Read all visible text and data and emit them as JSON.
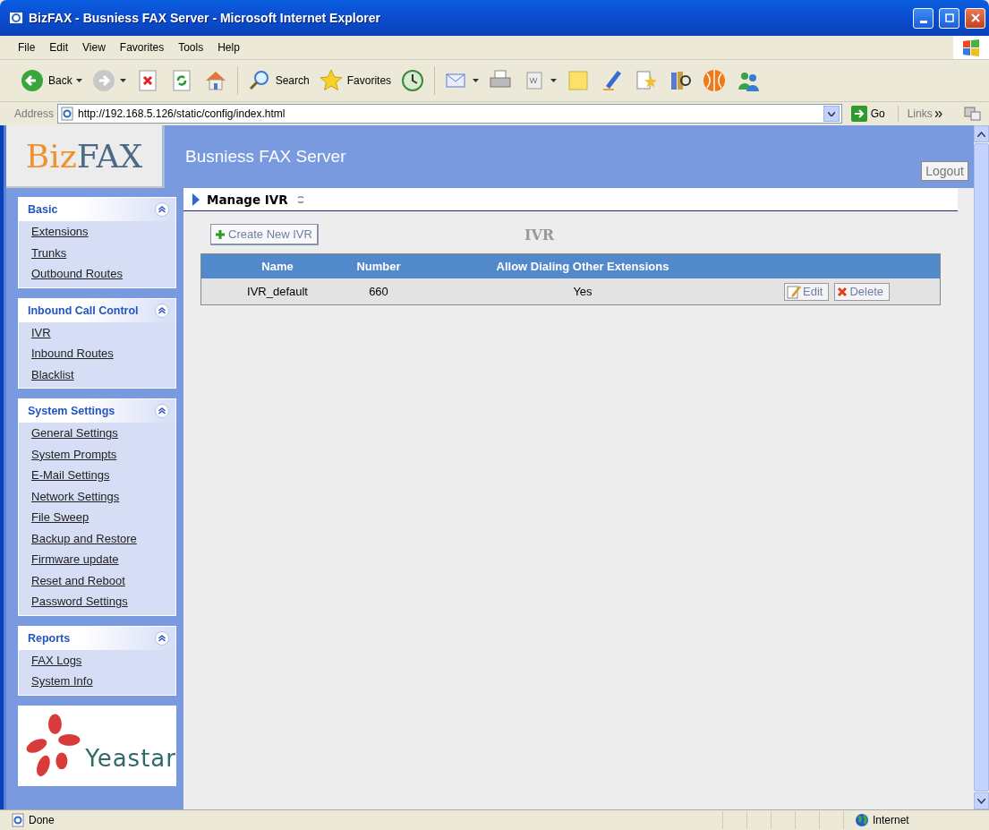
{
  "window": {
    "title": "BizFAX - Busniess FAX Server - Microsoft Internet Explorer"
  },
  "menu": [
    "File",
    "Edit",
    "View",
    "Favorites",
    "Tools",
    "Help"
  ],
  "toolbar": [
    {
      "kind": "back",
      "label": "Back"
    },
    {
      "kind": "forward"
    },
    {
      "kind": "stop"
    },
    {
      "kind": "refresh"
    },
    {
      "kind": "home"
    },
    {
      "kind": "search",
      "label": "Search"
    },
    {
      "kind": "favorites",
      "label": "Favorites"
    },
    {
      "kind": "history"
    },
    {
      "kind": "mail"
    },
    {
      "kind": "print"
    },
    {
      "kind": "edit"
    },
    {
      "kind": "note"
    },
    {
      "kind": "pen"
    },
    {
      "kind": "star"
    },
    {
      "kind": "book"
    },
    {
      "kind": "globe"
    },
    {
      "kind": "people"
    }
  ],
  "address": {
    "label": "Address",
    "value": "http://192.168.5.126/static/config/index.html",
    "go": "Go",
    "links": "Links"
  },
  "app": {
    "logo_first": "Biz",
    "logo_second": "FAX",
    "title": "Busniess FAX Server",
    "logout": "Logout"
  },
  "sidebar": [
    {
      "title": "Basic",
      "expanded": true,
      "items": [
        "Extensions",
        "Trunks",
        "Outbound Routes"
      ]
    },
    {
      "title": "Inbound Call Control",
      "expanded": true,
      "items": [
        "IVR",
        "Inbound Routes",
        "Blacklist"
      ]
    },
    {
      "title": "System Settings",
      "expanded": true,
      "items": [
        "General Settings",
        "System Prompts",
        "E-Mail Settings",
        "Network Settings",
        "File Sweep",
        "Backup and Restore",
        "Firmware update",
        "Reset and Reboot",
        "Password Settings"
      ]
    },
    {
      "title": "Reports",
      "expanded": true,
      "items": [
        "FAX Logs",
        "System Info"
      ]
    }
  ],
  "brand": "Yeastar",
  "breadcrumb": "Manage IVR",
  "create_button": "Create New IVR",
  "section_title": "IVR",
  "table": {
    "columns": [
      "Name",
      "Number",
      "Allow Dialing Other Extensions"
    ],
    "rows": [
      {
        "cells": [
          "IVR_default",
          "660",
          "Yes"
        ],
        "edit": "Edit",
        "delete": "Delete"
      }
    ]
  },
  "status_bar": {
    "text": "Done",
    "zone": "Internet"
  }
}
